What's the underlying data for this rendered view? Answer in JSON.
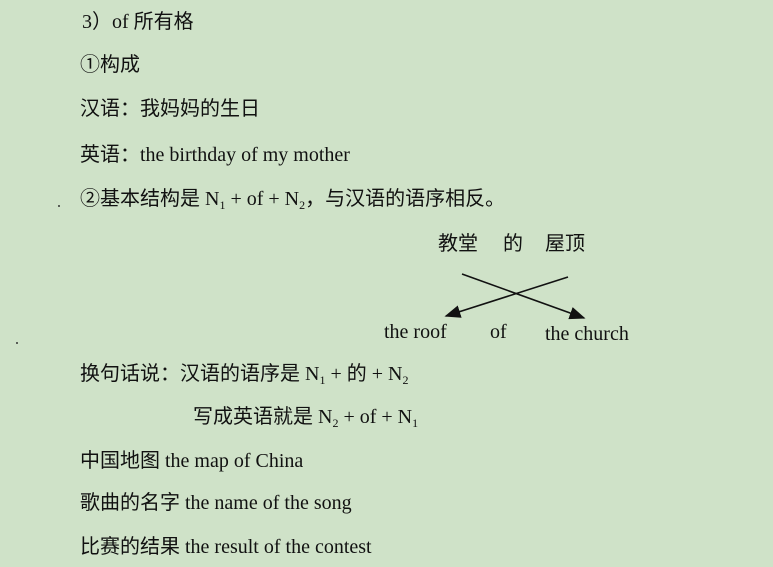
{
  "heading": "3）of 所有格",
  "section1": "①构成",
  "chinese_example": "汉语：我妈妈的生日",
  "english_example": "英语：the birthday of my mother",
  "structure": {
    "prefix": "②基本结构是 N",
    "sub1": "1",
    "mid": " + of + N",
    "sub2": "2",
    "suffix": "，与汉语的语序相反。"
  },
  "diagram": {
    "cn_1": "教堂",
    "cn_2": "的",
    "cn_3": "屋顶",
    "en_1": "the roof",
    "en_2": "of",
    "en_3": "the church"
  },
  "explain1": {
    "prefix": "换句话说：汉语的语序是 N",
    "sub1": "1",
    "mid": " + 的 + N",
    "sub2": "2"
  },
  "explain2": {
    "prefix": "写成英语就是 N",
    "sub1": "2",
    "mid": " + of + N",
    "sub2": "1"
  },
  "examples": [
    "中国地图 the map of China",
    "歌曲的名字 the name of the song",
    "比赛的结果 the result of the contest"
  ]
}
